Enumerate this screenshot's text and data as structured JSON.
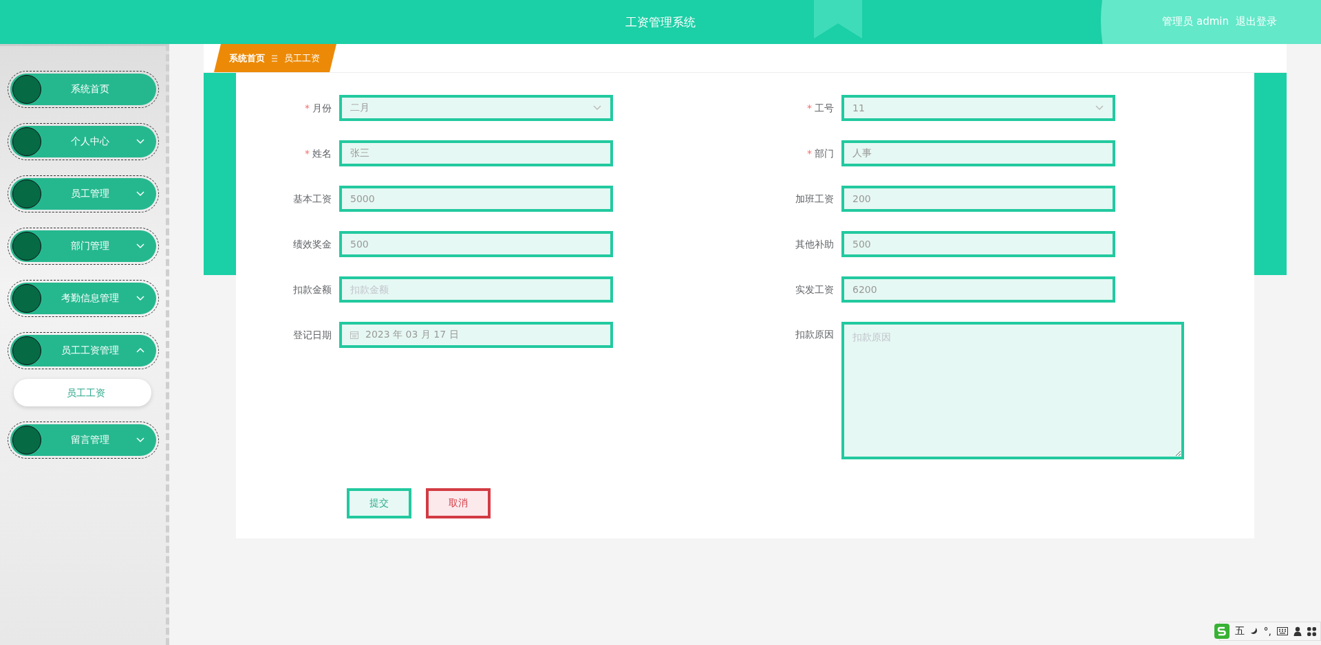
{
  "header": {
    "title": "工资管理系统",
    "user_label": "管理员 admin",
    "logout": "退出登录"
  },
  "sidebar": {
    "items": [
      {
        "label": "系统首页",
        "kind": "link"
      },
      {
        "label": "个人中心",
        "kind": "menu",
        "expanded": false
      },
      {
        "label": "员工管理",
        "kind": "menu",
        "expanded": false
      },
      {
        "label": "部门管理",
        "kind": "menu",
        "expanded": false
      },
      {
        "label": "考勤信息管理",
        "kind": "menu",
        "expanded": false
      },
      {
        "label": "员工工资管理",
        "kind": "menu",
        "expanded": true,
        "children": [
          {
            "label": "员工工资",
            "selected": true
          }
        ]
      },
      {
        "label": "留言管理",
        "kind": "menu",
        "expanded": false
      }
    ]
  },
  "breadcrumb": [
    "系统首页",
    "员工工资"
  ],
  "form": {
    "fields": [
      {
        "label": "月份",
        "required_mark": "*",
        "kind": "select",
        "value": "二月"
      },
      {
        "label": "工号",
        "required_mark": "*",
        "kind": "select",
        "value": "11"
      },
      {
        "label": "姓名",
        "required_mark": "*",
        "kind": "text",
        "value": "张三"
      },
      {
        "label": "部门",
        "required_mark": "*",
        "kind": "text",
        "value": "人事"
      },
      {
        "label": "基本工资",
        "kind": "text",
        "value": "5000"
      },
      {
        "label": "加班工资",
        "kind": "text",
        "value": "200"
      },
      {
        "label": "绩效奖金",
        "kind": "text",
        "value": "500"
      },
      {
        "label": "其他补助",
        "kind": "text",
        "value": "500"
      },
      {
        "label": "扣款金额",
        "kind": "text",
        "placeholder": "扣款金额"
      },
      {
        "label": "实发工资",
        "kind": "text",
        "value": "6200"
      },
      {
        "label": "登记日期",
        "kind": "date",
        "value": "2023 年 03 月 17 日"
      },
      {
        "label": "扣款原因",
        "kind": "textarea",
        "placeholder": "扣款原因"
      }
    ],
    "buttons": [
      {
        "label": "提交",
        "kind": "submit"
      },
      {
        "label": "取消",
        "kind": "cancel"
      }
    ]
  },
  "ime_bar": {
    "items": [
      "五",
      "°,"
    ]
  }
}
